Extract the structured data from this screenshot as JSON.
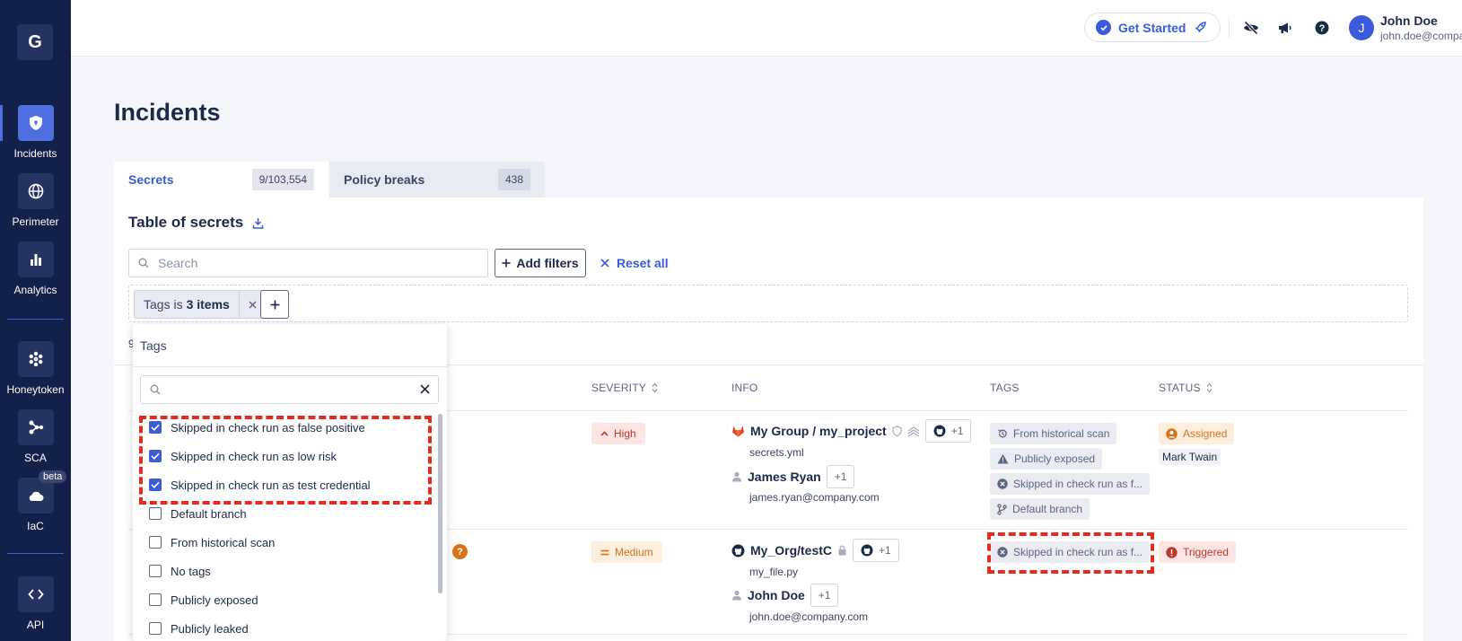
{
  "sidebar": {
    "logo": "G",
    "items": [
      {
        "label": "Incidents",
        "icon": "shield-icon"
      },
      {
        "label": "Perimeter",
        "icon": "globe-icon"
      },
      {
        "label": "Analytics",
        "icon": "bar-chart-icon"
      },
      {
        "label": "Honeytoken",
        "icon": "honeytoken-icon"
      },
      {
        "label": "SCA",
        "icon": "sca-graph-icon"
      },
      {
        "label": "IaC",
        "icon": "cloud-icon",
        "badge": "beta"
      },
      {
        "label": "API",
        "icon": "code-icon"
      }
    ]
  },
  "header": {
    "get_started": "Get Started",
    "user_initial": "J",
    "user_name": "John Doe",
    "user_email": "john.doe@company...."
  },
  "page": {
    "title": "Incidents"
  },
  "tabs": [
    {
      "label": "Secrets",
      "count": "9/103,554"
    },
    {
      "label": "Policy breaks",
      "count": "438"
    }
  ],
  "table_section": {
    "title": "Table of secrets",
    "search_placeholder": "Search",
    "add_filters": "Add filters",
    "reset_all": "Reset all",
    "filter_chip": {
      "prefix": "Tags is",
      "value": "3 items"
    },
    "row_count_fragment": "9"
  },
  "columns": {
    "severity": "SEVERITY",
    "info": "INFO",
    "tags": "TAGS",
    "status": "STATUS"
  },
  "rows": [
    {
      "severity": "High",
      "repo": "My Group / my_project",
      "repo_plus": "+1",
      "file": "secrets.yml",
      "user": "James Ryan",
      "user_plus": "+1",
      "user_email": "james.ryan@company.com",
      "tags": [
        "From historical scan",
        "Publicly exposed",
        "Skipped in check run as f...",
        "Default branch"
      ],
      "status": "Assigned",
      "assignee": "Mark Twain"
    },
    {
      "severity": "Medium",
      "repo": "My_Org/testC",
      "repo_plus": "+1",
      "file": "my_file.py",
      "user": "John Doe",
      "user_plus": "+1",
      "user_email": "john.doe@company.com",
      "tags": [
        "Skipped in check run as f..."
      ],
      "status": "Triggered",
      "qmark": "?"
    }
  ],
  "tags_dropdown": {
    "title": "Tags",
    "search_value": "",
    "options": [
      {
        "label": "Skipped in check run as false positive",
        "checked": true
      },
      {
        "label": "Skipped in check run as low risk",
        "checked": true
      },
      {
        "label": "Skipped in check run as test credential",
        "checked": true
      },
      {
        "label": "Default branch",
        "checked": false
      },
      {
        "label": "From historical scan",
        "checked": false
      },
      {
        "label": "No tags",
        "checked": false
      },
      {
        "label": "Publicly exposed",
        "checked": false
      },
      {
        "label": "Publicly leaked",
        "checked": false
      }
    ]
  },
  "colors": {
    "sidebar_bg": "#12204a",
    "accent": "#3b5bdb",
    "high": "#c0392b",
    "medium": "#d9731a",
    "highlight": "#e52b1e"
  }
}
